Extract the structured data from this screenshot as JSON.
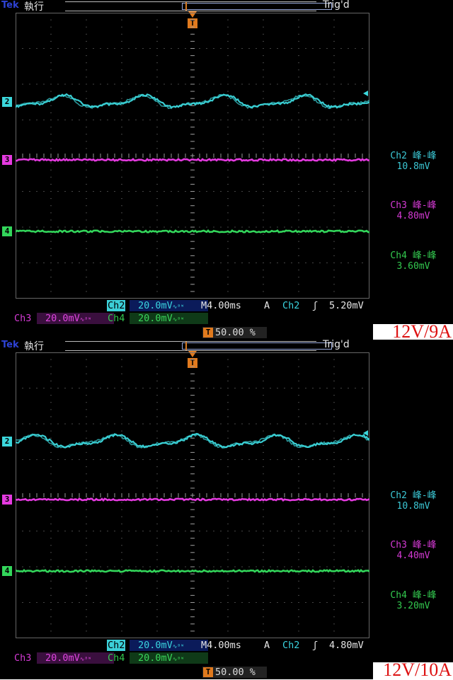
{
  "screens": [
    {
      "brand": "Tek",
      "state": "執行",
      "trigger_status": "Trig'd",
      "channel_markers": [
        "2",
        "3",
        "4"
      ],
      "trigger_marker": "T",
      "measurements": [
        {
          "label": "Ch2 峰-峰",
          "value": "10.8mV",
          "color": "#3cc9d6"
        },
        {
          "label": "Ch3 峰-峰",
          "value": "4.80mV",
          "color": "#d43ad4"
        },
        {
          "label": "Ch4 峰-峰",
          "value": "3.60mV",
          "color": "#33c94f"
        }
      ],
      "ch2_label": "Ch2",
      "ch2_scale": "20.0mV",
      "timebase": "M4.00ms",
      "trigger_mode": "A",
      "trigger_source": "Ch2",
      "trigger_edge": "ʃ",
      "trigger_level": "5.20mV",
      "ch3_label": "Ch3",
      "ch3_scale": "20.0mV",
      "ch4_label": "Ch4",
      "ch4_scale": "20.0mV",
      "bw_symbol": "∿ᴮᵂ",
      "trigger_position": "50.00 %",
      "caption": "12V/9A"
    },
    {
      "brand": "Tek",
      "state": "執行",
      "trigger_status": "Trig'd",
      "channel_markers": [
        "2",
        "3",
        "4"
      ],
      "trigger_marker": "T",
      "measurements": [
        {
          "label": "Ch2 峰-峰",
          "value": "10.8mV",
          "color": "#3cc9d6"
        },
        {
          "label": "Ch3 峰-峰",
          "value": "4.40mV",
          "color": "#d43ad4"
        },
        {
          "label": "Ch4 峰-峰",
          "value": "3.20mV",
          "color": "#33c94f"
        }
      ],
      "ch2_label": "Ch2",
      "ch2_scale": "20.0mV",
      "timebase": "M4.00ms",
      "trigger_mode": "A",
      "trigger_source": "Ch2",
      "trigger_edge": "ʃ",
      "trigger_level": "4.80mV",
      "ch3_label": "Ch3",
      "ch3_scale": "20.0mV",
      "ch4_label": "Ch4",
      "ch4_scale": "20.0mV",
      "bw_symbol": "∿ᴮᵂ",
      "trigger_position": "50.00 %",
      "caption": "12V/10A"
    }
  ],
  "colors": {
    "ch2": "#3cd7dc",
    "ch3": "#e53ae0",
    "ch4": "#33d65b",
    "trigger": "#e07a1e",
    "caption": "#dd1111"
  }
}
